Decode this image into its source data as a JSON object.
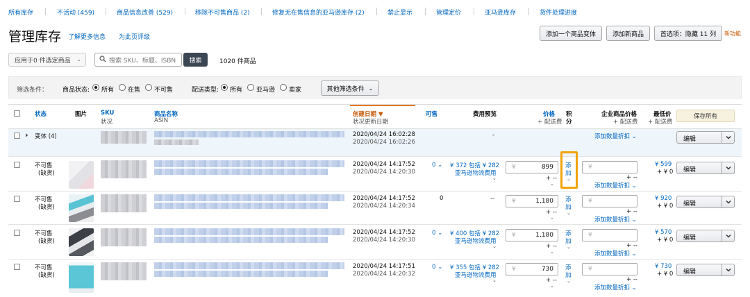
{
  "nav": {
    "items": [
      "所有库存",
      "不活动 (459)",
      "商品信息改善 (529)",
      "移除不可售商品 (2)",
      "修复无在售信息的亚马逊库存 (2)",
      "禁止显示",
      "管理定价",
      "亚马逊库存",
      "货件处理进度"
    ]
  },
  "header": {
    "title": "管理库存",
    "learn_more": "了解更多信息",
    "rate_page": "为此页评级",
    "buttons": {
      "add_variation": "添加一个商品变体",
      "add_product": "添加新商品",
      "preferences": "首选项：隐藏 11 列"
    },
    "new_feature": "新功能"
  },
  "bulk": {
    "action_select": "应用于0 件选定商品",
    "search_placeholder": "搜索 SKU、标题、ISBN",
    "search_button": "搜索",
    "count": "1020 件商品"
  },
  "filters": {
    "label": "筛选条件：",
    "status_label": "商品状态:",
    "status_options": [
      "所有",
      "在售",
      "不可售"
    ],
    "fulfillment_label": "配送类型:",
    "fulfillment_options": [
      "所有",
      "亚马逊",
      "卖家"
    ],
    "more": "其他筛选条件"
  },
  "table": {
    "headers": {
      "status": "状态",
      "image": "图片",
      "sku": "SKU",
      "sku_sub": "状况",
      "name": "商品名称",
      "name_sub": "ASIN",
      "created": "创建日期 ▼",
      "created_sub": "状况更新日期",
      "available": "可售",
      "fee": "费用预览",
      "price": "价格",
      "price_sub": "+ 配送费",
      "points_1": "积",
      "points_2": "分",
      "business": "企业商品价格",
      "business_sub": "+ 配送费",
      "lowest": "最低价",
      "lowest_sub": "+ 配送费",
      "save_all": "保存所有"
    },
    "variant_row": {
      "label": "变体 (4)",
      "created": "2020/04/24 16:02:28",
      "updated": "2020/04/24 16:02:26",
      "fee": "-",
      "bulk_discount": "添加数量折扣 ⌄",
      "edit": "编辑"
    },
    "rows": [
      {
        "status_1": "不可售",
        "status_2": "(缺货)",
        "created": "2020/04/24 14:17:52",
        "updated": "2020/04/24 14:20:30",
        "available": "0 ⌄",
        "fee_1": "¥ 372 包括 ¥ 282",
        "fee_2": "亚马逊物流费用",
        "currency": "¥",
        "price": "899",
        "shipping": "+ --",
        "points_1": "添",
        "points_2": "加",
        "bulk_discount": "添加数量折扣 ⌄",
        "lowest_1": "¥ 599",
        "lowest_2": "+ ¥ 0",
        "edit": "编辑"
      },
      {
        "status_1": "不可售",
        "status_2": "(缺货)",
        "created": "2020/04/24 14:17:52",
        "updated": "2020/04/24 14:20:34",
        "available": "0",
        "fee_1": "--",
        "fee_2": "",
        "currency": "¥",
        "price": "1,180",
        "shipping": "+ --",
        "points_1": "添",
        "points_2": "加",
        "bulk_discount": "添加数量折扣 ⌄",
        "lowest_1": "¥ 920",
        "lowest_2": "+ ¥ 0",
        "edit": "编辑"
      },
      {
        "status_1": "不可售",
        "status_2": "(缺货)",
        "created": "2020/04/24 14:17:52",
        "updated": "2020/04/24 14:20:30",
        "available": "0 ⌄",
        "fee_1": "¥ 400 包括 ¥ 282",
        "fee_2": "亚马逊物流费用",
        "currency": "¥",
        "price": "1,180",
        "shipping": "+ --",
        "points_1": "添",
        "points_2": "加",
        "bulk_discount": "添加数量折扣 ⌄",
        "lowest_1": "¥ 570",
        "lowest_2": "+ ¥ 0",
        "edit": "编辑"
      },
      {
        "status_1": "不可售",
        "status_2": "(缺货)",
        "created": "2020/04/24 14:17:51",
        "updated": "2020/04/24 14:20:32",
        "available": "0 ⌄",
        "fee_1": "¥ 355 包括 ¥ 282",
        "fee_2": "亚马逊物流费用",
        "currency": "¥",
        "price": "730",
        "shipping": "+ --",
        "points_1": "添",
        "points_2": "加",
        "bulk_discount": "添加数量折扣 ⌄",
        "lowest_1": "¥ 730",
        "lowest_2": "+ ¥ 0",
        "edit": "编辑"
      }
    ]
  },
  "colors": {
    "link": "#0066c0",
    "accent": "#e77600",
    "highlight": "#f0a30a"
  }
}
